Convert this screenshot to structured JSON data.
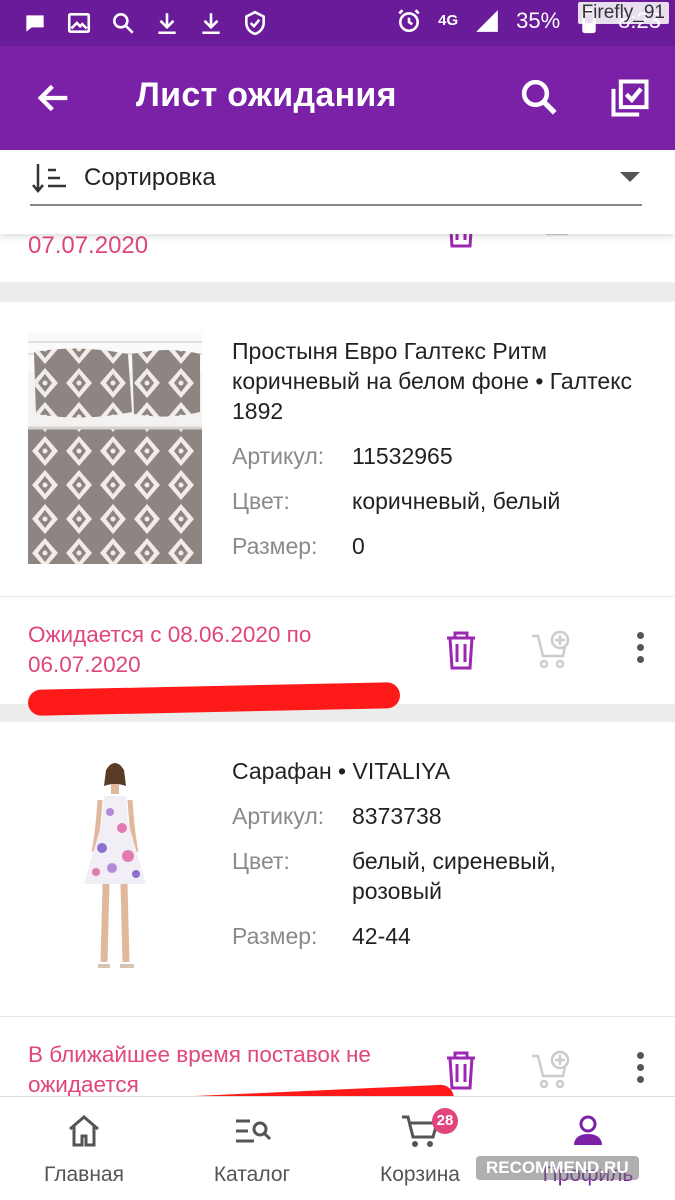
{
  "status_bar": {
    "battery": "35%",
    "network": "4G",
    "time": "8:23",
    "watermark": "Firefly_91"
  },
  "app_bar": {
    "title": "Лист ожидания"
  },
  "sort": {
    "label": "Сортировка"
  },
  "previous_item": {
    "availability": "07.07.2020"
  },
  "items": [
    {
      "name": "Простыня Евро Галтекс Ритм коричневый на белом фоне • Галтекс 1892",
      "article_label": "Артикул:",
      "article": "11532965",
      "color_label": "Цвет:",
      "color": "коричневый, белый",
      "size_label": "Размер:",
      "size": "0",
      "availability": "Ожидается с 08.06.2020 по 06.07.2020"
    },
    {
      "name": "Сарафан • VITALIYA",
      "article_label": "Артикул:",
      "article": "8373738",
      "color_label": "Цвет:",
      "color": "белый, сиреневый, розовый",
      "size_label": "Размер:",
      "size": "42-44",
      "availability": "В ближайшее время поставок не ожидается"
    }
  ],
  "bottom_nav": [
    {
      "label": "Главная",
      "icon": "home-icon"
    },
    {
      "label": "Каталог",
      "icon": "catalog-search-icon"
    },
    {
      "label": "Корзина",
      "icon": "cart-icon",
      "badge": "28"
    },
    {
      "label": "Профиль",
      "icon": "profile-icon",
      "active": true
    }
  ],
  "watermark_bottom": "RECOMMEND.RU",
  "colors": {
    "primary": "#7b21a8",
    "accent_pink": "#e0457e",
    "scribble_red": "#ff1a1a"
  }
}
